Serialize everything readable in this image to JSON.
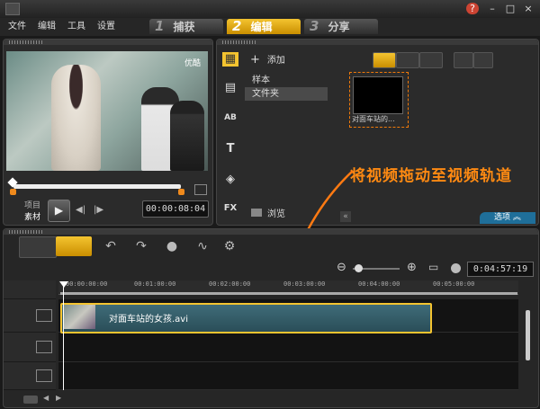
{
  "app": {
    "icon_name": "app-icon",
    "accent_color": "#f4c430",
    "instruction_color": "#ff8a12"
  },
  "menu": [
    {
      "label": "文件"
    },
    {
      "label": "编辑"
    },
    {
      "label": "工具"
    },
    {
      "label": "设置"
    }
  ],
  "steps": [
    {
      "num": "1",
      "label": "捕获"
    },
    {
      "num": "2",
      "label": "编辑"
    },
    {
      "num": "3",
      "label": "分享"
    }
  ],
  "window_controls": {
    "help": "?",
    "minimize": "–",
    "maximize": "□",
    "close": "×"
  },
  "preview": {
    "watermark": "优酷",
    "mode_project": "项目",
    "mode_clip": "素材",
    "timecode": "00:00:08:04",
    "controls": {
      "play": "▶",
      "prev": "◀|",
      "next": "|▶"
    }
  },
  "library": {
    "add_label": "添加",
    "folders": [
      {
        "label": "样本"
      },
      {
        "label": "文件夹"
      }
    ],
    "browse_label": "浏览",
    "side_icons": [
      {
        "name": "media-icon",
        "glyph": "▦"
      },
      {
        "name": "transition-icon",
        "glyph": "▤"
      },
      {
        "name": "title-icon",
        "glyph": "AB"
      },
      {
        "name": "text-icon",
        "glyph": "T"
      },
      {
        "name": "graphic-icon",
        "glyph": "◈"
      },
      {
        "name": "fx-icon",
        "glyph": "FX"
      }
    ],
    "thumb_caption": "对面车站的...",
    "options_label": "选项",
    "collapse_glyph": "«"
  },
  "annotation": {
    "text": "将视频拖动至视频轨道"
  },
  "timeline": {
    "timecode": "0:04:57:19",
    "ruler_labels": [
      "00:00:00:00",
      "00:01:00:00",
      "00:02:00:00",
      "00:03:00:00",
      "00:04:00:00",
      "00:05:00:00"
    ],
    "clip_name": "对面车站的女孩.avi",
    "tools": {
      "undo": "↶",
      "redo": "↷",
      "record": "●",
      "audio": "∿",
      "smart": "⚙"
    },
    "zoom": {
      "out": "⊖",
      "in": "⊕",
      "fit": "▭"
    }
  }
}
